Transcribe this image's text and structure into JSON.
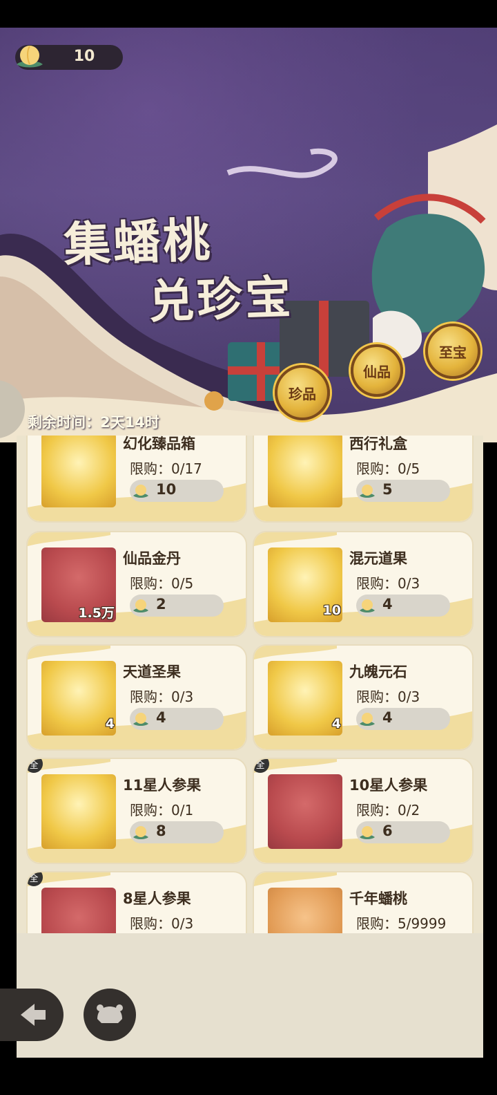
{
  "currency": {
    "icon": "peach-icon",
    "amount": "10"
  },
  "banner": {
    "title_line1": "集蟠桃",
    "title_line2": "兑珍宝",
    "timer": "剩余时间：2天14时"
  },
  "tiers": [
    {
      "label": "珍品"
    },
    {
      "label": "仙品"
    },
    {
      "label": "至宝"
    }
  ],
  "items": [
    {
      "name": "幻化臻品箱",
      "limit": "限购：0/17",
      "price": "10",
      "qty": "",
      "bg": "gold",
      "icon": "chest-icon",
      "tag": ""
    },
    {
      "name": "西行礼盒",
      "limit": "限购：0/5",
      "price": "5",
      "qty": "",
      "bg": "gold",
      "icon": "giftbox-icon",
      "tag": ""
    },
    {
      "name": "仙品金丹",
      "limit": "限购：0/5",
      "price": "2",
      "qty": "1.5万",
      "bg": "red",
      "icon": "elixir-icon",
      "tag": ""
    },
    {
      "name": "混元道果",
      "limit": "限购：0/3",
      "price": "4",
      "qty": "10",
      "bg": "gold",
      "icon": "orb-fruit-icon",
      "tag": ""
    },
    {
      "name": "天道圣果",
      "limit": "限购：0/3",
      "price": "4",
      "qty": "4",
      "bg": "gold",
      "icon": "sacred-fruit-icon",
      "tag": ""
    },
    {
      "name": "九魄元石",
      "limit": "限购：0/3",
      "price": "4",
      "qty": "4",
      "bg": "gold",
      "icon": "crystal-icon",
      "tag": ""
    },
    {
      "name": "11星人参果",
      "limit": "限购：0/1",
      "price": "8",
      "qty": "",
      "bg": "gold",
      "icon": "ginseng-fruit-icon",
      "tag": "全"
    },
    {
      "name": "10星人参果",
      "limit": "限购：0/2",
      "price": "6",
      "qty": "",
      "bg": "red",
      "icon": "ginseng-fruit-icon",
      "tag": "全"
    },
    {
      "name": "8星人参果",
      "limit": "限购：0/3",
      "price": "",
      "qty": "",
      "bg": "red",
      "icon": "ginseng-fruit-icon",
      "tag": "全"
    },
    {
      "name": "千年蟠桃",
      "limit": "限购：5/9999",
      "price": "",
      "qty": "",
      "bg": "orange",
      "icon": "peach-icon",
      "tag": ""
    }
  ],
  "nav": {
    "back_icon": "back-arrow-icon",
    "pet_icon": "pet-icon"
  }
}
